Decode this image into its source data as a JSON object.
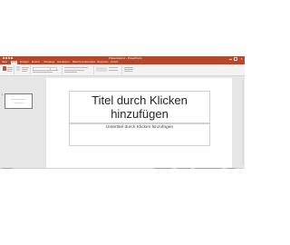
{
  "app": {
    "accent_color": "#b7472a",
    "window_title": "Präsentation1 - PowerPoint"
  },
  "ribbon": {
    "tabs": [
      "Datei",
      "Start",
      "Einfügen",
      "Entwurf",
      "Übergänge",
      "Animationen",
      "Bildschirmpräsentation",
      "Überprüfen",
      "Ansicht"
    ],
    "active_tab": "Start"
  },
  "slides_panel": {
    "slides": [
      {
        "number": "1"
      }
    ]
  },
  "slide": {
    "title_placeholder": "Titel durch Klicken hinzufügen",
    "subtitle_placeholder": "Untertitel durch Klicken hinzufügen"
  }
}
